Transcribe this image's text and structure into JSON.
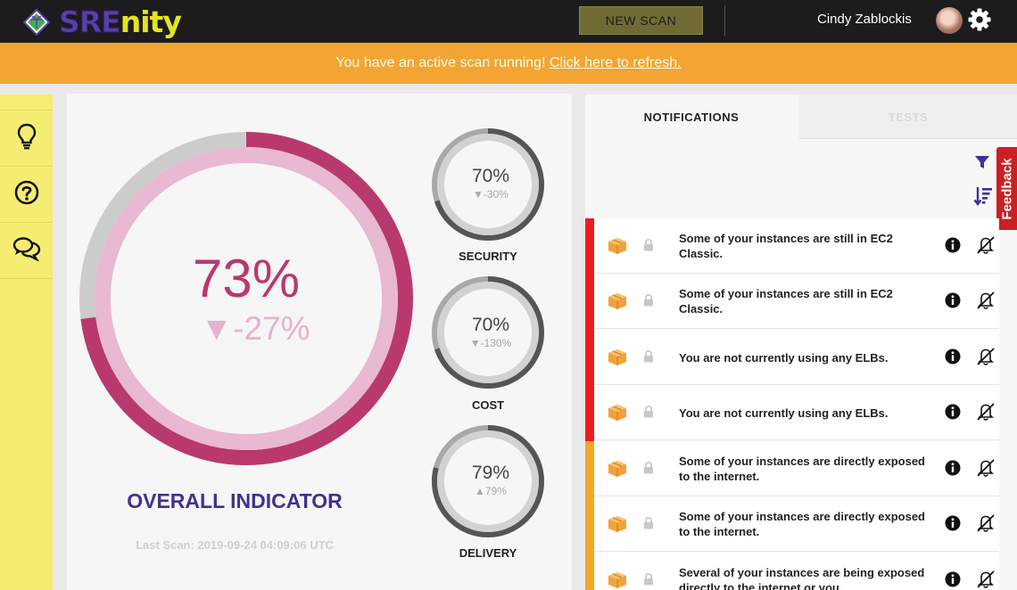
{
  "header": {
    "logo": {
      "part1": "SRE",
      "part2": "nity"
    },
    "new_scan_label": "NEW SCAN",
    "user_name": "Cindy Zablockis",
    "icons": [
      "logo-icon",
      "avatar",
      "gear-icon"
    ]
  },
  "banner": {
    "text": "You have an active scan running!",
    "link": "Click here to refresh."
  },
  "sidebar": {
    "items": [
      {
        "icon": "lightbulb-icon"
      },
      {
        "icon": "help-icon"
      },
      {
        "icon": "chat-icon"
      }
    ]
  },
  "overall": {
    "percent": "73%",
    "delta": "▼-27%",
    "value": 0.73,
    "label": "OVERALL INDICATOR",
    "last_scan": "Last Scan: 2019-09-24 04:09:06 UTC"
  },
  "gauges": [
    {
      "percent": "70%",
      "delta": "▼-30%",
      "label": "SECURITY",
      "value": 0.7
    },
    {
      "percent": "70%",
      "delta": "▼-130%",
      "label": "COST",
      "value": 0.7
    },
    {
      "percent": "79%",
      "delta": "▲79%",
      "label": "DELIVERY",
      "value": 0.79
    }
  ],
  "panel": {
    "tabs": [
      "NOTIFICATIONS",
      "TESTS"
    ],
    "active_tab": "NOTIFICATIONS",
    "feedback_label": "Feedback"
  },
  "notifications": [
    {
      "severity": "critical",
      "message": "Some of your instances are still in EC2 Classic."
    },
    {
      "severity": "critical",
      "message": "Some of your instances are still in EC2 Classic."
    },
    {
      "severity": "critical",
      "message": "You are not currently using any ELBs."
    },
    {
      "severity": "critical",
      "message": "You are not currently using any ELBs."
    },
    {
      "severity": "warning",
      "message": "Some of your instances are directly exposed to the internet."
    },
    {
      "severity": "warning",
      "message": "Some of your instances are directly exposed to the internet."
    },
    {
      "severity": "warning",
      "message": "Several of your instances are being exposed directly to the internet or you"
    }
  ],
  "colors": {
    "topbar": "#1c1c1c",
    "banner": "#f2a533",
    "sidebar": "#f5ed71",
    "overall_ring": "#b9396f",
    "overall_ring_light": "#e9b8d2",
    "title": "#3f338f",
    "critical": "#ee1d1d",
    "warning": "#f5a623",
    "box_icon": "#f1a23a"
  }
}
